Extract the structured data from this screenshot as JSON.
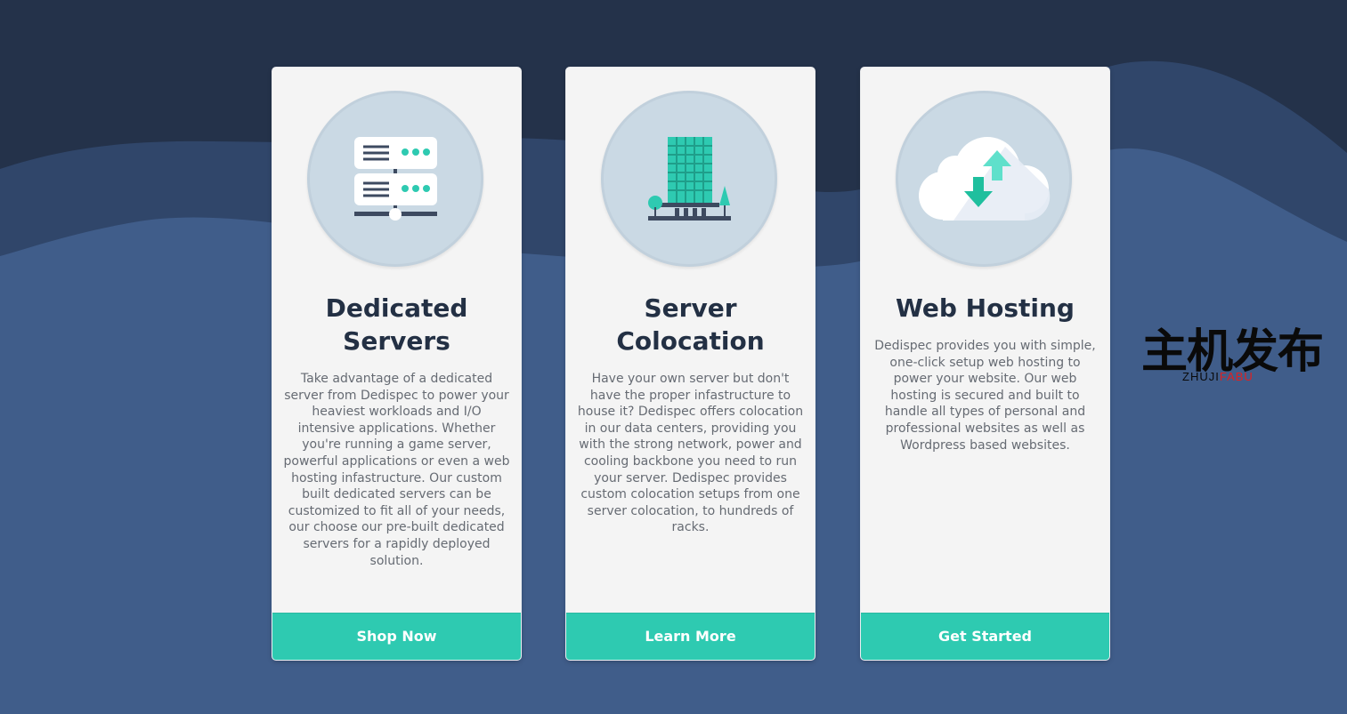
{
  "cards": [
    {
      "icon": "server-rack-icon",
      "title": "Dedicated Servers",
      "title_lines": [
        "Dedicated",
        "Servers"
      ],
      "description": "Take advantage of a dedicated server from Dedispec to power your heaviest workloads and I/O intensive applications. Whether you're running a game server, powerful applications or even a web hosting infastructure. Our custom built dedicated servers can be customized to fit all of your needs, our choose our pre-built dedicated servers for a rapidly deployed solution.",
      "button_label": "Shop Now"
    },
    {
      "icon": "datacenter-building-icon",
      "title": "Server Colocation",
      "title_lines": [
        "Server",
        "Colocation"
      ],
      "description": "Have your own server but don't have the proper infastructure to house it? Dedispec offers colocation in our data centers, providing you with the strong network, power and cooling backbone you need to run your server. Dedispec provides custom colocation setups from one server colocation, to hundreds of racks.",
      "button_label": "Learn More"
    },
    {
      "icon": "cloud-upload-download-icon",
      "title": "Web Hosting",
      "title_lines": [
        "Web Hosting"
      ],
      "description": "Dedispec provides you with simple, one-click setup web hosting to power your website. Our web hosting is secured and built to handle all types of personal and professional websites as well as Wordpress based websites.",
      "button_label": "Get Started"
    }
  ],
  "watermark": {
    "text": "主机发布",
    "sub_a": "ZHUJI",
    "sub_b": "FABU"
  },
  "colors": {
    "background_dark": "#24324a",
    "background_mid": "#30466a",
    "background_light": "#405d8a",
    "card": "#f4f4f4",
    "accent": "#2ecab1",
    "title": "#233044",
    "text": "#666b73"
  }
}
